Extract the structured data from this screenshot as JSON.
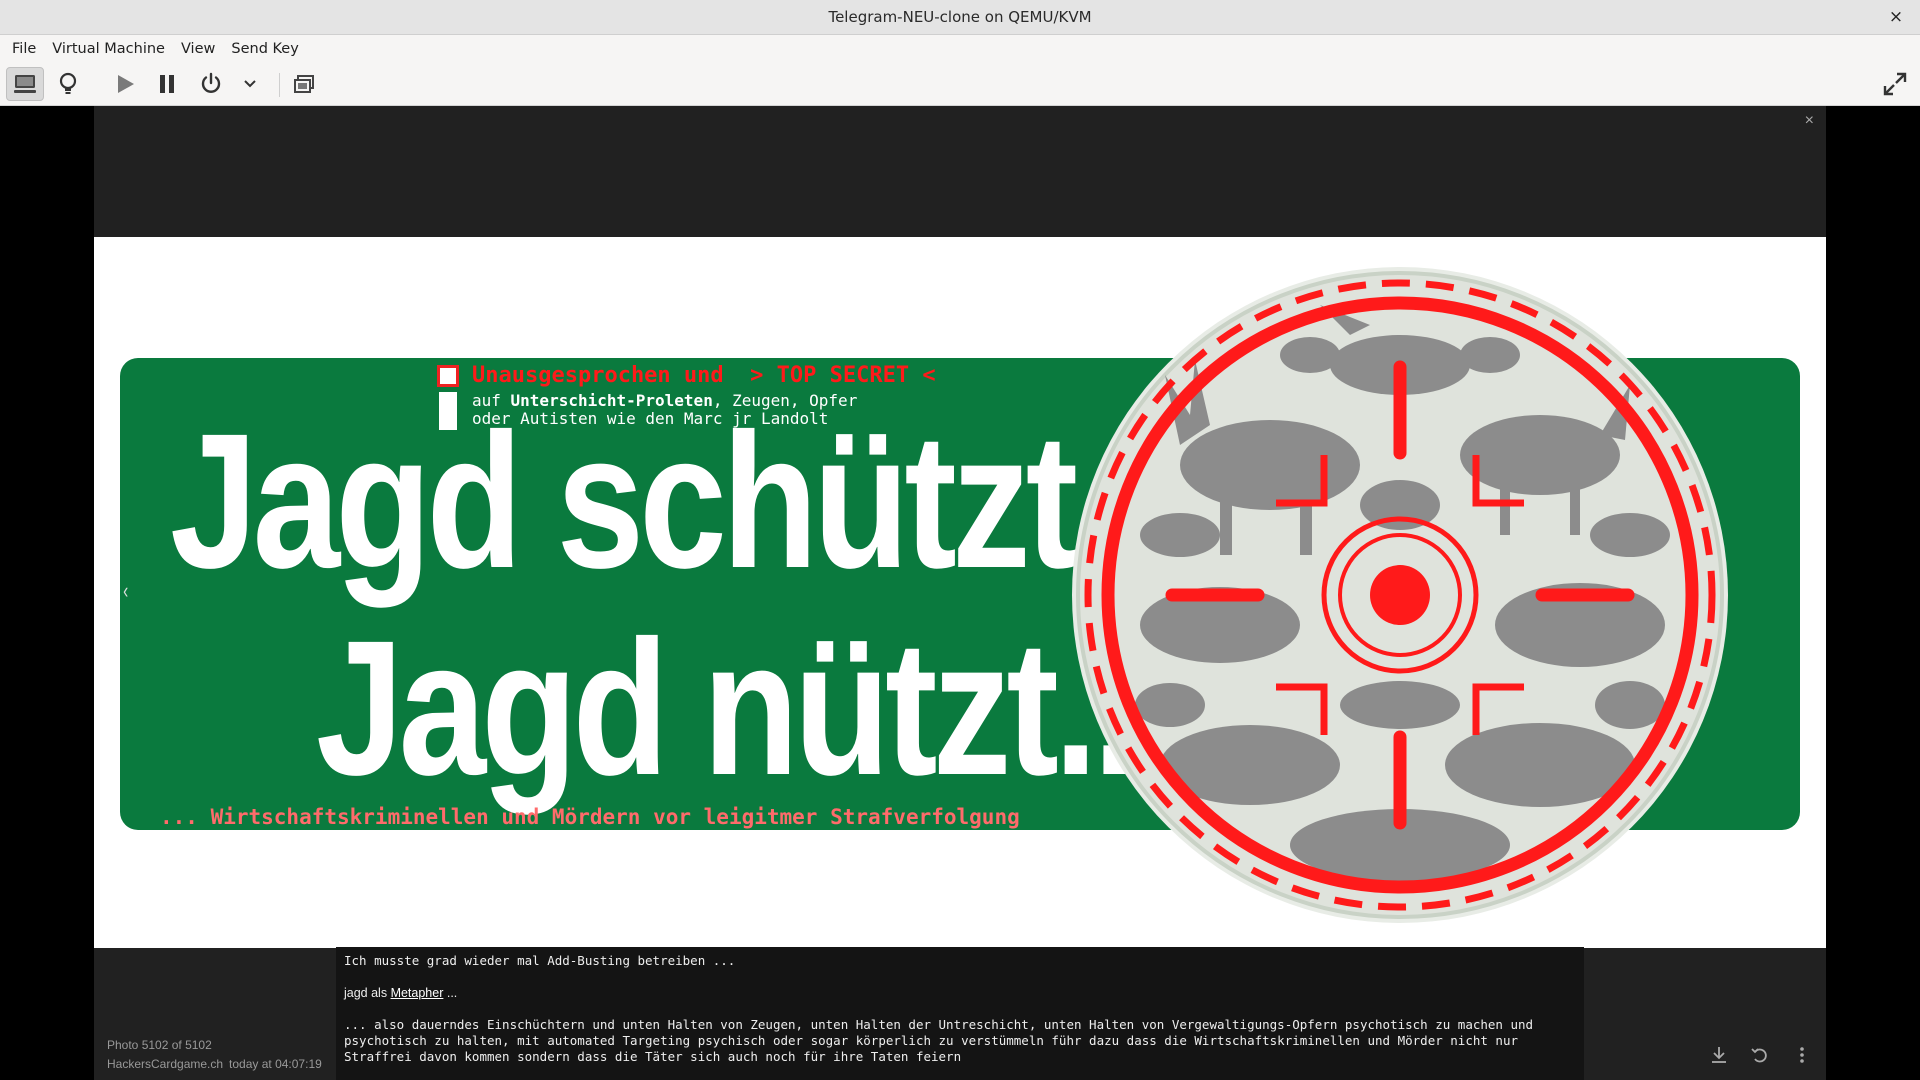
{
  "window": {
    "title": "Telegram-NEU-clone on QEMU/KVM",
    "close_glyph": "×"
  },
  "menu": [
    "File",
    "Virtual Machine",
    "View",
    "Send Key"
  ],
  "toolbar": {
    "buttons": [
      {
        "name": "console-icon",
        "active": true
      },
      {
        "name": "details-lightbulb-icon",
        "active": false
      },
      {
        "name": "run-icon",
        "active": false
      },
      {
        "name": "pause-icon",
        "active": false
      },
      {
        "name": "power-icon",
        "active": false
      },
      {
        "name": "chevron-down-icon",
        "active": false
      },
      {
        "name": "snapshots-icon",
        "active": false
      },
      {
        "name": "fullscreen-icon",
        "active": false
      }
    ]
  },
  "viewer": {
    "close_glyph": "×",
    "prev_glyph": "‹",
    "photo": {
      "secret_line": "Unausgesprochen und  > TOP SECRET <",
      "sub_prefix": "auf ",
      "sub_bold": "Unterschicht-Proleten",
      "sub_rest": ", Zeugen, Opfer",
      "sub_line2": "oder Autisten wie den Marc jr Landolt",
      "big_line1": "Jagd schützt.",
      "big_line2": "Jagd nützt...",
      "bottom_line": "... Wirtschaftskriminellen und Mördern vor leigitmer Strafverfolgung",
      "colors": {
        "green": "#0a7a3e",
        "red": "#ff1a1a",
        "silhouette": "#8c8c8c",
        "disc": "#dfe3dc"
      }
    },
    "caption": {
      "line1": "Ich musste grad wieder mal Add-Busting betreiben ...",
      "line2_prefix": "jagd als ",
      "line2_link": "Metapher",
      "line2_suffix": " ...",
      "paragraph": "... also dauerndes Einschüchtern und unten Halten von Zeugen, unten Halten der Untreschicht, unten Halten von Vergewaltigungs-Opfern psychotisch zu machen und psychotisch zu halten, mit automated Targeting psychisch oder sogar körperlich zu verstümmeln führ dazu dass die Wirtschaftskriminellen und Mörder nicht nur Straffrei davon kommen sondern dass die Täter sich auch noch für ihre Taten feiern"
    },
    "footer": {
      "counter": "Photo 5102 of 5102",
      "source": "HackersCardgame.ch",
      "time": "today at 04:07:19",
      "icons": [
        "download-icon",
        "rotate-icon",
        "more-icon"
      ]
    }
  }
}
